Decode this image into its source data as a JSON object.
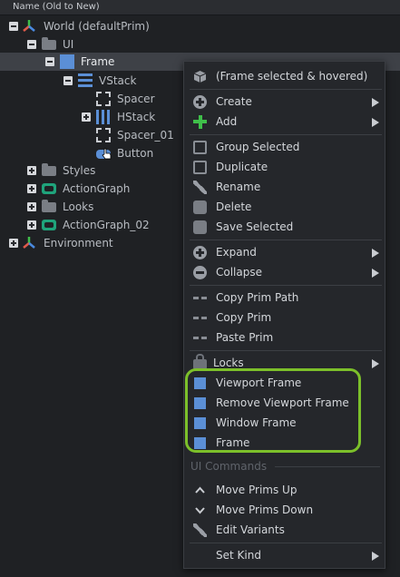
{
  "tree": {
    "column_header": "Name (Old to New)",
    "rows": [
      {
        "label": "World (defaultPrim)"
      },
      {
        "label": "UI"
      },
      {
        "label": "Frame"
      },
      {
        "label": "VStack"
      },
      {
        "label": "Spacer"
      },
      {
        "label": "HStack"
      },
      {
        "label": "Spacer_01"
      },
      {
        "label": "Button"
      },
      {
        "label": "Styles"
      },
      {
        "label": "ActionGraph"
      },
      {
        "label": "Looks"
      },
      {
        "label": "ActionGraph_02"
      },
      {
        "label": "Environment"
      }
    ]
  },
  "menu": {
    "header": "(Frame selected & hovered)",
    "items": {
      "create": "Create",
      "add": "Add",
      "group_selected": "Group Selected",
      "duplicate": "Duplicate",
      "rename": "Rename",
      "delete": "Delete",
      "save_selected": "Save Selected",
      "expand": "Expand",
      "collapse": "Collapse",
      "copy_prim_path": "Copy Prim Path",
      "copy_prim": "Copy Prim",
      "paste_prim": "Paste Prim",
      "locks": "Locks",
      "viewport_frame": "Viewport Frame",
      "remove_viewport_frame": "Remove Viewport Frame",
      "window_frame": "Window Frame",
      "frame": "Frame",
      "ui_commands": "UI Commands",
      "move_prims_up": "Move Prims Up",
      "move_prims_down": "Move Prims Down",
      "edit_variants": "Edit Variants",
      "set_kind": "Set Kind"
    }
  },
  "colors": {
    "accent_blue": "#5b8fd6",
    "highlight_green": "#7cc02a",
    "graph_teal": "#1fa37b"
  }
}
